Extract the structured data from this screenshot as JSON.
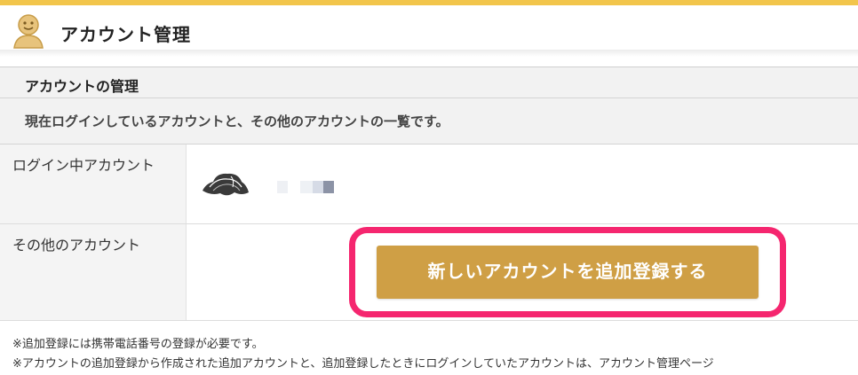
{
  "header": {
    "icon": "user-icon",
    "title": "アカウント管理"
  },
  "section": {
    "title": "アカウントの管理",
    "description": "現在ログインしているアカウントと、その他のアカウントの一覧です。"
  },
  "rows": [
    {
      "label": "ログイン中アカウント",
      "avatar": "user-avatar"
    },
    {
      "label": "その他のアカウント"
    }
  ],
  "add_button": {
    "label": "新しいアカウントを追加登録する"
  },
  "notes": [
    "※追加登録には携帯電話番号の登録が必要です。",
    "※アカウントの追加登録から作成された追加アカウントと、追加登録したときにログインしていたアカウントは、アカウント管理ページ"
  ],
  "colors": {
    "accent": "#f2c54b",
    "button": "#cf9f45",
    "highlight": "#f5266f"
  }
}
